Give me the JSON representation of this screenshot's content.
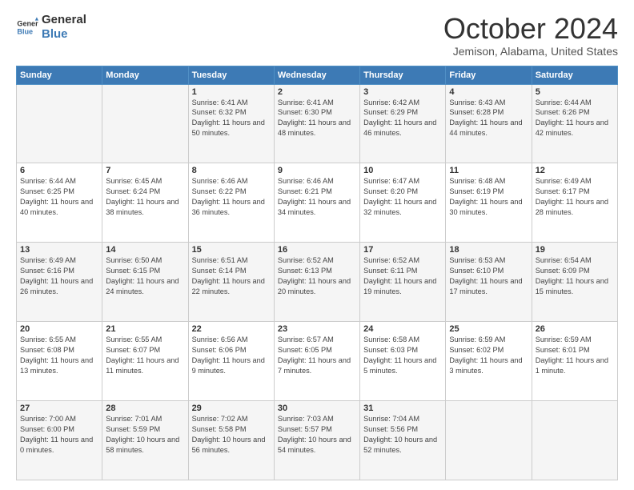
{
  "header": {
    "logo_line1": "General",
    "logo_line2": "Blue",
    "month": "October 2024",
    "location": "Jemison, Alabama, United States"
  },
  "weekdays": [
    "Sunday",
    "Monday",
    "Tuesday",
    "Wednesday",
    "Thursday",
    "Friday",
    "Saturday"
  ],
  "weeks": [
    [
      {
        "day": "",
        "info": ""
      },
      {
        "day": "",
        "info": ""
      },
      {
        "day": "1",
        "info": "Sunrise: 6:41 AM\nSunset: 6:32 PM\nDaylight: 11 hours and 50 minutes."
      },
      {
        "day": "2",
        "info": "Sunrise: 6:41 AM\nSunset: 6:30 PM\nDaylight: 11 hours and 48 minutes."
      },
      {
        "day": "3",
        "info": "Sunrise: 6:42 AM\nSunset: 6:29 PM\nDaylight: 11 hours and 46 minutes."
      },
      {
        "day": "4",
        "info": "Sunrise: 6:43 AM\nSunset: 6:28 PM\nDaylight: 11 hours and 44 minutes."
      },
      {
        "day": "5",
        "info": "Sunrise: 6:44 AM\nSunset: 6:26 PM\nDaylight: 11 hours and 42 minutes."
      }
    ],
    [
      {
        "day": "6",
        "info": "Sunrise: 6:44 AM\nSunset: 6:25 PM\nDaylight: 11 hours and 40 minutes."
      },
      {
        "day": "7",
        "info": "Sunrise: 6:45 AM\nSunset: 6:24 PM\nDaylight: 11 hours and 38 minutes."
      },
      {
        "day": "8",
        "info": "Sunrise: 6:46 AM\nSunset: 6:22 PM\nDaylight: 11 hours and 36 minutes."
      },
      {
        "day": "9",
        "info": "Sunrise: 6:46 AM\nSunset: 6:21 PM\nDaylight: 11 hours and 34 minutes."
      },
      {
        "day": "10",
        "info": "Sunrise: 6:47 AM\nSunset: 6:20 PM\nDaylight: 11 hours and 32 minutes."
      },
      {
        "day": "11",
        "info": "Sunrise: 6:48 AM\nSunset: 6:19 PM\nDaylight: 11 hours and 30 minutes."
      },
      {
        "day": "12",
        "info": "Sunrise: 6:49 AM\nSunset: 6:17 PM\nDaylight: 11 hours and 28 minutes."
      }
    ],
    [
      {
        "day": "13",
        "info": "Sunrise: 6:49 AM\nSunset: 6:16 PM\nDaylight: 11 hours and 26 minutes."
      },
      {
        "day": "14",
        "info": "Sunrise: 6:50 AM\nSunset: 6:15 PM\nDaylight: 11 hours and 24 minutes."
      },
      {
        "day": "15",
        "info": "Sunrise: 6:51 AM\nSunset: 6:14 PM\nDaylight: 11 hours and 22 minutes."
      },
      {
        "day": "16",
        "info": "Sunrise: 6:52 AM\nSunset: 6:13 PM\nDaylight: 11 hours and 20 minutes."
      },
      {
        "day": "17",
        "info": "Sunrise: 6:52 AM\nSunset: 6:11 PM\nDaylight: 11 hours and 19 minutes."
      },
      {
        "day": "18",
        "info": "Sunrise: 6:53 AM\nSunset: 6:10 PM\nDaylight: 11 hours and 17 minutes."
      },
      {
        "day": "19",
        "info": "Sunrise: 6:54 AM\nSunset: 6:09 PM\nDaylight: 11 hours and 15 minutes."
      }
    ],
    [
      {
        "day": "20",
        "info": "Sunrise: 6:55 AM\nSunset: 6:08 PM\nDaylight: 11 hours and 13 minutes."
      },
      {
        "day": "21",
        "info": "Sunrise: 6:55 AM\nSunset: 6:07 PM\nDaylight: 11 hours and 11 minutes."
      },
      {
        "day": "22",
        "info": "Sunrise: 6:56 AM\nSunset: 6:06 PM\nDaylight: 11 hours and 9 minutes."
      },
      {
        "day": "23",
        "info": "Sunrise: 6:57 AM\nSunset: 6:05 PM\nDaylight: 11 hours and 7 minutes."
      },
      {
        "day": "24",
        "info": "Sunrise: 6:58 AM\nSunset: 6:03 PM\nDaylight: 11 hours and 5 minutes."
      },
      {
        "day": "25",
        "info": "Sunrise: 6:59 AM\nSunset: 6:02 PM\nDaylight: 11 hours and 3 minutes."
      },
      {
        "day": "26",
        "info": "Sunrise: 6:59 AM\nSunset: 6:01 PM\nDaylight: 11 hours and 1 minute."
      }
    ],
    [
      {
        "day": "27",
        "info": "Sunrise: 7:00 AM\nSunset: 6:00 PM\nDaylight: 11 hours and 0 minutes."
      },
      {
        "day": "28",
        "info": "Sunrise: 7:01 AM\nSunset: 5:59 PM\nDaylight: 10 hours and 58 minutes."
      },
      {
        "day": "29",
        "info": "Sunrise: 7:02 AM\nSunset: 5:58 PM\nDaylight: 10 hours and 56 minutes."
      },
      {
        "day": "30",
        "info": "Sunrise: 7:03 AM\nSunset: 5:57 PM\nDaylight: 10 hours and 54 minutes."
      },
      {
        "day": "31",
        "info": "Sunrise: 7:04 AM\nSunset: 5:56 PM\nDaylight: 10 hours and 52 minutes."
      },
      {
        "day": "",
        "info": ""
      },
      {
        "day": "",
        "info": ""
      }
    ]
  ]
}
